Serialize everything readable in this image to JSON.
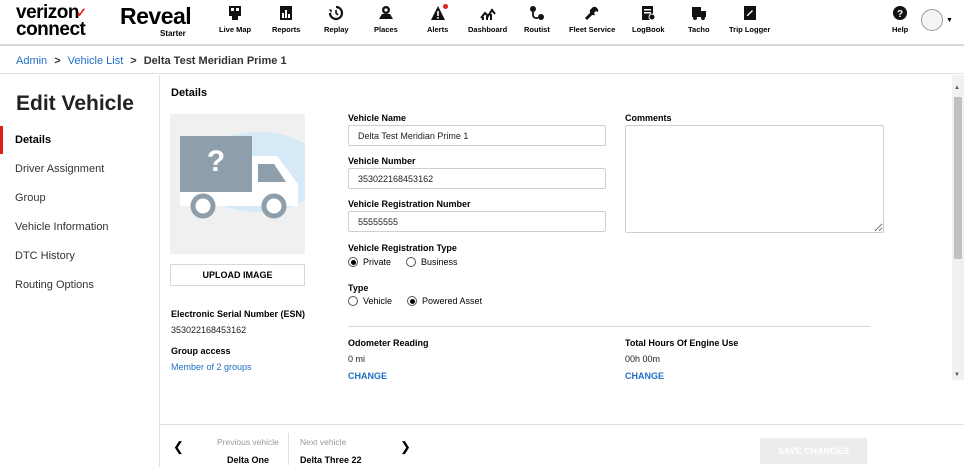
{
  "brand": {
    "logo_line1": "verizon",
    "logo_check": "✓",
    "logo_line2": "connect",
    "product": "Reveal",
    "tier": "Starter"
  },
  "nav": [
    {
      "label": "Live Map",
      "icon": "live-map-icon"
    },
    {
      "label": "Reports",
      "icon": "reports-icon"
    },
    {
      "label": "Replay",
      "icon": "replay-icon"
    },
    {
      "label": "Places",
      "icon": "places-icon"
    },
    {
      "label": "Alerts",
      "icon": "alerts-icon"
    },
    {
      "label": "Dashboard",
      "icon": "dashboard-icon"
    },
    {
      "label": "Routist",
      "icon": "routist-icon"
    },
    {
      "label": "Fleet Service",
      "icon": "fleet-service-icon"
    },
    {
      "label": "LogBook",
      "icon": "logbook-icon"
    },
    {
      "label": "Tacho",
      "icon": "tacho-icon"
    },
    {
      "label": "Trip Logger",
      "icon": "trip-logger-icon"
    }
  ],
  "help": {
    "label": "Help"
  },
  "breadcrumb": {
    "admin": "Admin",
    "vehicle_list": "Vehicle List",
    "current": "Delta Test Meridian Prime 1",
    "separator": ">"
  },
  "sidebar": {
    "title": "Edit Vehicle",
    "items": [
      {
        "label": "Details"
      },
      {
        "label": "Driver Assignment"
      },
      {
        "label": "Group"
      },
      {
        "label": "Vehicle Information"
      },
      {
        "label": "DTC History"
      },
      {
        "label": "Routing Options"
      }
    ]
  },
  "details": {
    "section_title": "Details",
    "upload_label": "UPLOAD IMAGE",
    "esn_label": "Electronic Serial Number (ESN)",
    "esn_value": "353022168453162",
    "group_access_label": "Group access",
    "group_access_link": "Member of 2 groups",
    "vehicle_name_label": "Vehicle Name",
    "vehicle_name_value": "Delta Test Meridian Prime 1",
    "vehicle_number_label": "Vehicle Number",
    "vehicle_number_value": "353022168453162",
    "reg_number_label": "Vehicle Registration Number",
    "reg_number_value": "55555555",
    "reg_type_label": "Vehicle Registration Type",
    "reg_type_options": [
      "Private",
      "Business"
    ],
    "reg_type_selected": "Private",
    "type_label": "Type",
    "type_options": [
      "Vehicle",
      "Powered Asset"
    ],
    "type_selected": "Powered Asset",
    "comments_label": "Comments",
    "comments_value": "",
    "odometer_label": "Odometer Reading",
    "odometer_value": "0 mi",
    "engine_hours_label": "Total Hours Of Engine Use",
    "engine_hours_value": "00h 00m",
    "change_label": "CHANGE"
  },
  "footer": {
    "previous_label": "Previous vehicle",
    "previous_name": "Delta One",
    "next_label": "Next vehicle",
    "next_name": "Delta Three 22",
    "save_label": "SAVE CHANGES"
  },
  "colors": {
    "accent": "#e0201b",
    "link": "#1f6fc5"
  }
}
